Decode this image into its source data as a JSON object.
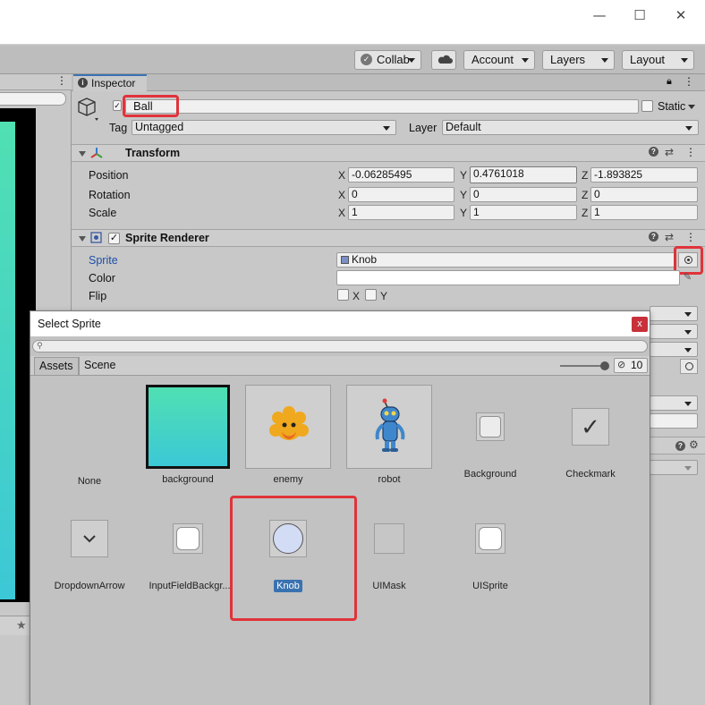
{
  "window": {
    "minimize_icon": "minimize-icon",
    "maximize_icon": "maximize-icon",
    "close_icon": "close-icon",
    "min_glyph": "—",
    "max_glyph": "☐",
    "close_glyph": "✕"
  },
  "toolbar": {
    "collab_label": "Collab",
    "account_label": "Account",
    "layers_label": "Layers",
    "layout_label": "Layout"
  },
  "inspector": {
    "tab_label": "Inspector",
    "name_value": "Ball",
    "static_label": "Static",
    "tag_label": "Tag",
    "tag_value": "Untagged",
    "layer_label": "Layer",
    "layer_value": "Default",
    "transform": {
      "title": "Transform",
      "position_label": "Position",
      "rotation_label": "Rotation",
      "scale_label": "Scale",
      "x": "X",
      "y": "Y",
      "z": "Z",
      "position": [
        "-0.06285495",
        "0.4761018",
        "-1.893825"
      ],
      "rotation": [
        "0",
        "0",
        "0"
      ],
      "scale": [
        "1",
        "1",
        "1"
      ]
    },
    "sprite_renderer": {
      "title": "Sprite Renderer",
      "sprite_label": "Sprite",
      "sprite_value": "Knob",
      "color_label": "Color",
      "flip_label": "Flip",
      "flip_x": "X",
      "flip_y": "Y"
    }
  },
  "dialog": {
    "title": "Select Sprite",
    "close_glyph": "x",
    "tabs": [
      "Assets",
      "Scene"
    ],
    "count": "10",
    "items_row1": [
      "None",
      "background",
      "enemy",
      "robot",
      "Background",
      "Checkmark"
    ],
    "items_row2": [
      "DropdownArrow",
      "InputFieldBackgr...",
      "Knob",
      "UIMask",
      "UISprite"
    ],
    "selected": "Knob"
  },
  "colors": {
    "highlight_red": "#e0333a",
    "selection_blue": "#3a72b0",
    "background_gradient_top": "#50e0b2",
    "background_gradient_bottom": "#3cc8d6"
  }
}
